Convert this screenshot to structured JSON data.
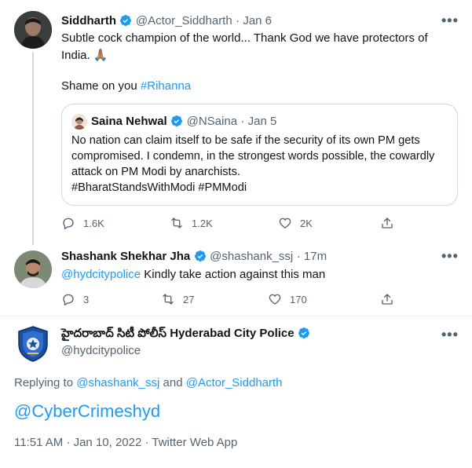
{
  "tweet1": {
    "name": "Siddharth",
    "handle": "@Actor_Siddharth",
    "time": "· Jan 6",
    "line1": "Subtle cock champion of the world... Thank God we have protectors of",
    "line2": "India. 🙏🏽",
    "line3_prefix": "Shame on you ",
    "hashtag": "#Rihanna",
    "more": "•••",
    "quote": {
      "name": "Saina Nehwal",
      "handle": "@NSaina",
      "time": "· Jan 5",
      "l1": "No nation can claim itself to be safe if the security of its own PM gets",
      "l2": "compromised. I condemn, in the strongest words possible, the cowardly",
      "l3": "attack on PM Modi by anarchists.",
      "l4": "#BharatStandsWithModi #PMModi"
    },
    "replies": "1.6K",
    "retweets": "1.2K",
    "likes": "2K"
  },
  "tweet2": {
    "name": "Shashank Shekhar Jha",
    "handle": "@shashank_ssj",
    "time": "· 17m",
    "mention": "@hydcitypolice",
    "text": " Kindly take action against this man",
    "more": "•••",
    "replies": "3",
    "retweets": "27",
    "likes": "170"
  },
  "tweet3": {
    "name": "హైదరాబాద్ సిటీ పోలీస్ Hyderabad City Police",
    "handle": "@hydcitypolice",
    "more": "•••",
    "replying_prefix": "Replying to ",
    "replying_user1": "@shashank_ssj",
    "replying_and": " and ",
    "replying_user2": "@Actor_Siddharth",
    "main_text": "@CyberCrimeshyd",
    "meta": "11:51 AM · Jan 10, 2022 · Twitter Web App"
  },
  "colors": {
    "link": "#1d9bf0",
    "muted": "#536471",
    "verified": "#1d9bf0"
  }
}
